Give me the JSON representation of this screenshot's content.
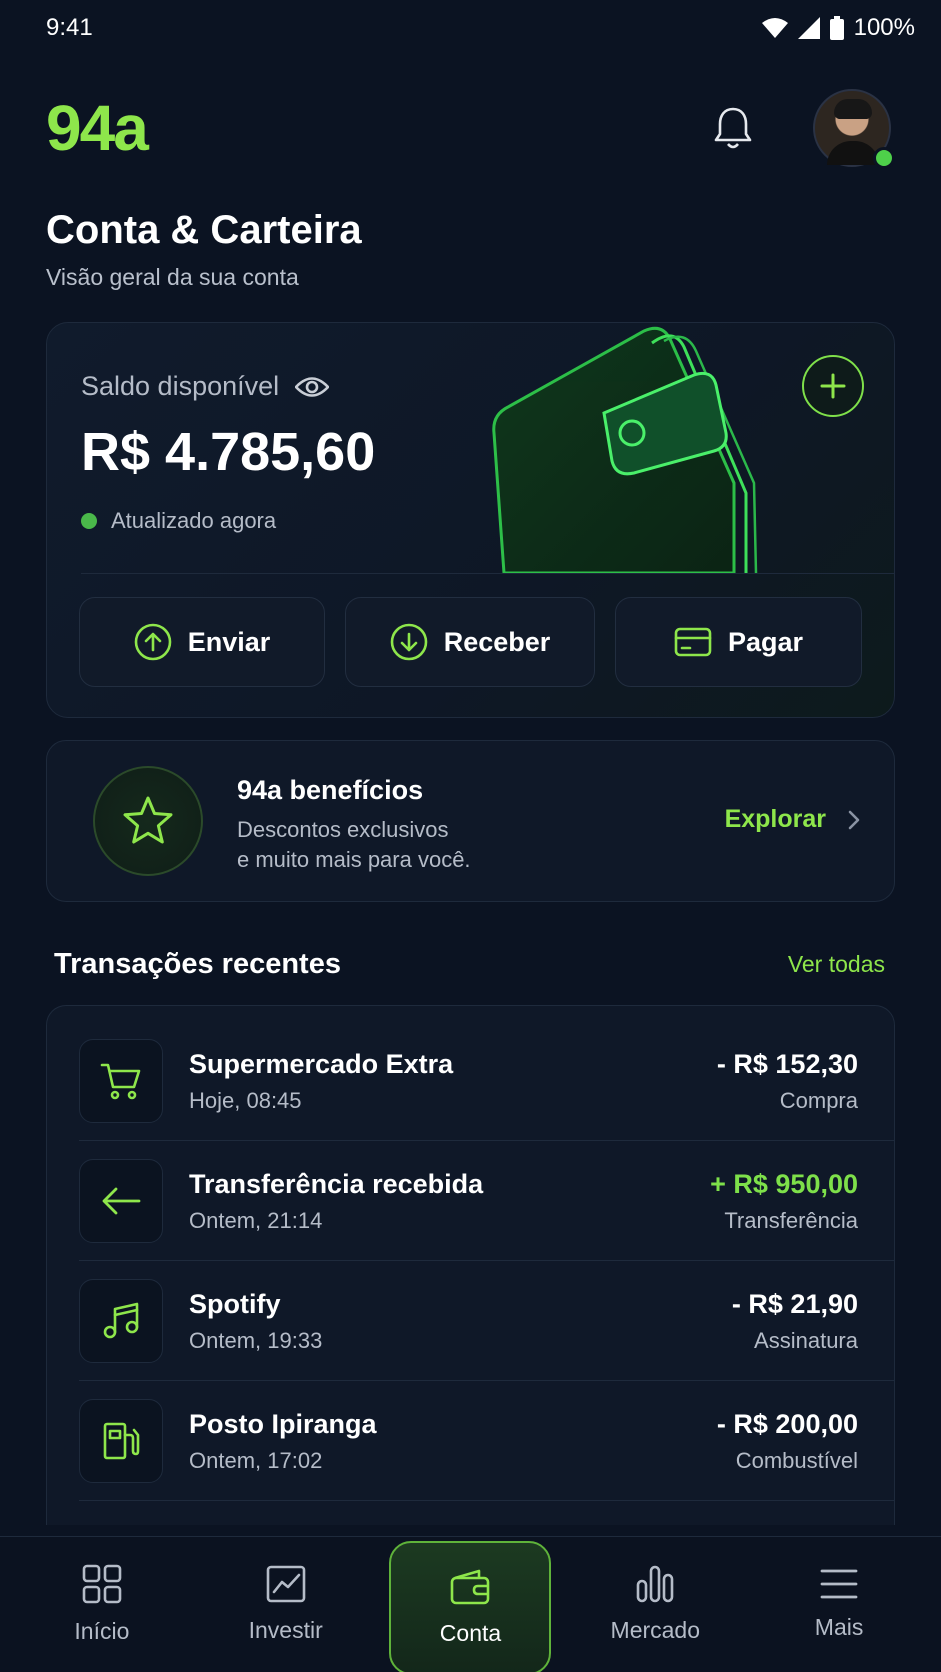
{
  "status_bar": {
    "time": "9:41",
    "battery": "100%"
  },
  "header": {
    "logo": "94a"
  },
  "page": {
    "title": "Conta & Carteira",
    "subtitle": "Visão geral da sua conta"
  },
  "balance": {
    "label": "Saldo disponível",
    "amount": "R$ 4.785,60",
    "updated": "Atualizado agora"
  },
  "actions": [
    {
      "label": "Enviar",
      "icon": "arrow-up-circle-icon"
    },
    {
      "label": "Receber",
      "icon": "arrow-down-circle-icon"
    },
    {
      "label": "Pagar",
      "icon": "credit-card-icon"
    }
  ],
  "benefits": {
    "title": "94a benefícios",
    "desc_line1": "Descontos exclusivos",
    "desc_line2": "e muito mais para você.",
    "cta": "Explorar"
  },
  "transactions": {
    "title": "Transações recentes",
    "see_all": "Ver todas",
    "items": [
      {
        "name": "Supermercado Extra",
        "time": "Hoje, 08:45",
        "amount": "- R$ 152,30",
        "category": "Compra",
        "icon": "cart-icon"
      },
      {
        "name": "Transferência recebida",
        "time": "Ontem, 21:14",
        "amount": "+ R$ 950,00",
        "category": "Transferência",
        "icon": "arrow-left-icon"
      },
      {
        "name": "Spotify",
        "time": "Ontem, 19:33",
        "amount": "- R$ 21,90",
        "category": "Assinatura",
        "icon": "music-icon"
      },
      {
        "name": "Posto Ipiranga",
        "time": "Ontem, 17:02",
        "amount": "- R$ 200,00",
        "category": "Combustível",
        "icon": "fuel-icon"
      }
    ]
  },
  "nav": [
    {
      "label": "Início",
      "icon": "grid-icon"
    },
    {
      "label": "Investir",
      "icon": "chart-line-icon"
    },
    {
      "label": "Conta",
      "icon": "wallet-icon",
      "active": true
    },
    {
      "label": "Mercado",
      "icon": "bar-chart-icon"
    },
    {
      "label": "Mais",
      "icon": "menu-icon"
    }
  ],
  "colors": {
    "accent": "#8ee64b",
    "background": "#0b1322",
    "card": "#0f1828",
    "positive": "#7ee04a"
  }
}
